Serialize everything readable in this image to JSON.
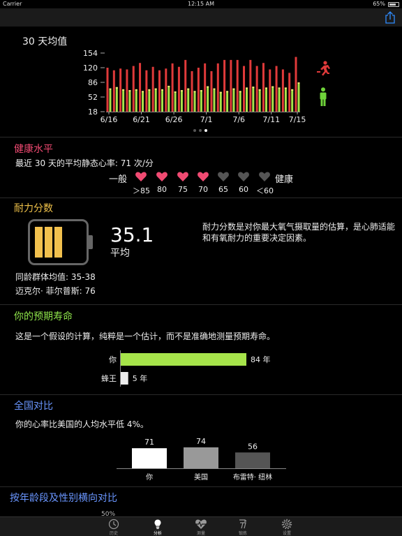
{
  "status": {
    "carrier": "Carrier",
    "time": "12:15 AM",
    "battery": "65%"
  },
  "avg30": {
    "title": "30 天均值",
    "y_ticks": [
      "154",
      "120",
      "86",
      "52",
      "18"
    ],
    "x_ticks": [
      "6/16",
      "6/21",
      "6/26",
      "7/1",
      "7/6",
      "7/11",
      "7/15"
    ],
    "colors": {
      "active": "#e03a3a",
      "rest": "#a6e44a",
      "rest_bar_top": "#f0ea7a"
    }
  },
  "chart_data": {
    "type": "bar",
    "title": "30 天均值",
    "ylim": [
      18,
      154
    ],
    "y_ticks": [
      154,
      120,
      86,
      52,
      18
    ],
    "x_tick_labels": [
      "6/16",
      "6/21",
      "6/26",
      "7/1",
      "7/6",
      "7/11",
      "7/15"
    ],
    "series": [
      {
        "values": [
          120,
          114,
          118,
          116,
          124,
          131,
          114,
          122,
          114,
          118,
          130,
          122,
          138,
          112,
          120,
          130,
          112,
          130,
          138,
          138,
          138,
          124,
          138,
          124,
          131,
          116,
          124,
          116,
          108,
          145
        ]
      },
      {
        "values": [
          72,
          75,
          70,
          68,
          70,
          66,
          70,
          72,
          70,
          78,
          65,
          68,
          72,
          66,
          68,
          77,
          72,
          64,
          66,
          72,
          66,
          74,
          76,
          70,
          74,
          77,
          74,
          74,
          70,
          86
        ]
      }
    ]
  },
  "health": {
    "title": "健康水平",
    "subtitle": "最近 30 天的平均静态心率:  71 次/分",
    "left_label": "一般",
    "right_label": "健康",
    "levels": [
      "＞85",
      "80",
      "75",
      "70",
      "65",
      "60",
      "＜60"
    ],
    "filled_count": 4,
    "color_filled": "#f04a72",
    "color_empty": "#555555"
  },
  "endurance": {
    "title": "耐力分数",
    "score": "35.1",
    "score_label": "平均",
    "description": "耐力分数是对你最大氧气摄取量的估算，是心肺适能和有氧耐力的重要决定因素。",
    "peer_avg": "同龄群体均值:    35-38",
    "athlete": "迈克尔· 菲尔普斯:  76",
    "battery_fill": 0.5
  },
  "lifespan": {
    "title": "你的预期寿命",
    "description": "这是一个假设的计算，纯粹是一个估计，而不是准确地测量预期寿命。",
    "bars": [
      {
        "label": "你",
        "value_label": "84 年",
        "value": 84,
        "color": "#a6e44a"
      },
      {
        "label": "蜂王",
        "value_label": "5 年",
        "value": 5,
        "color": "#eeeeee"
      }
    ]
  },
  "national": {
    "title": "全国对比",
    "description": "你的心率比美国的人均水平低 4%。",
    "bars": [
      {
        "label": "你",
        "value": 71,
        "value_label": "71",
        "color": "#ffffff"
      },
      {
        "label": "美国",
        "value": 74,
        "value_label": "74",
        "color": "#999999"
      },
      {
        "label": "布雷特· 纽林",
        "value": 56,
        "value_label": "56",
        "color": "#555555"
      }
    ]
  },
  "cohort": {
    "title": "按年龄段及性别横向对比",
    "partial_tick": "50%"
  },
  "tabs": [
    {
      "label": "历史",
      "icon": "clock-icon"
    },
    {
      "label": "分析",
      "icon": "lightbulb-icon"
    },
    {
      "label": "测量",
      "icon": "heart-icon"
    },
    {
      "label": "锻炼",
      "icon": "running-icon"
    },
    {
      "label": "设置",
      "icon": "gear-icon"
    }
  ]
}
